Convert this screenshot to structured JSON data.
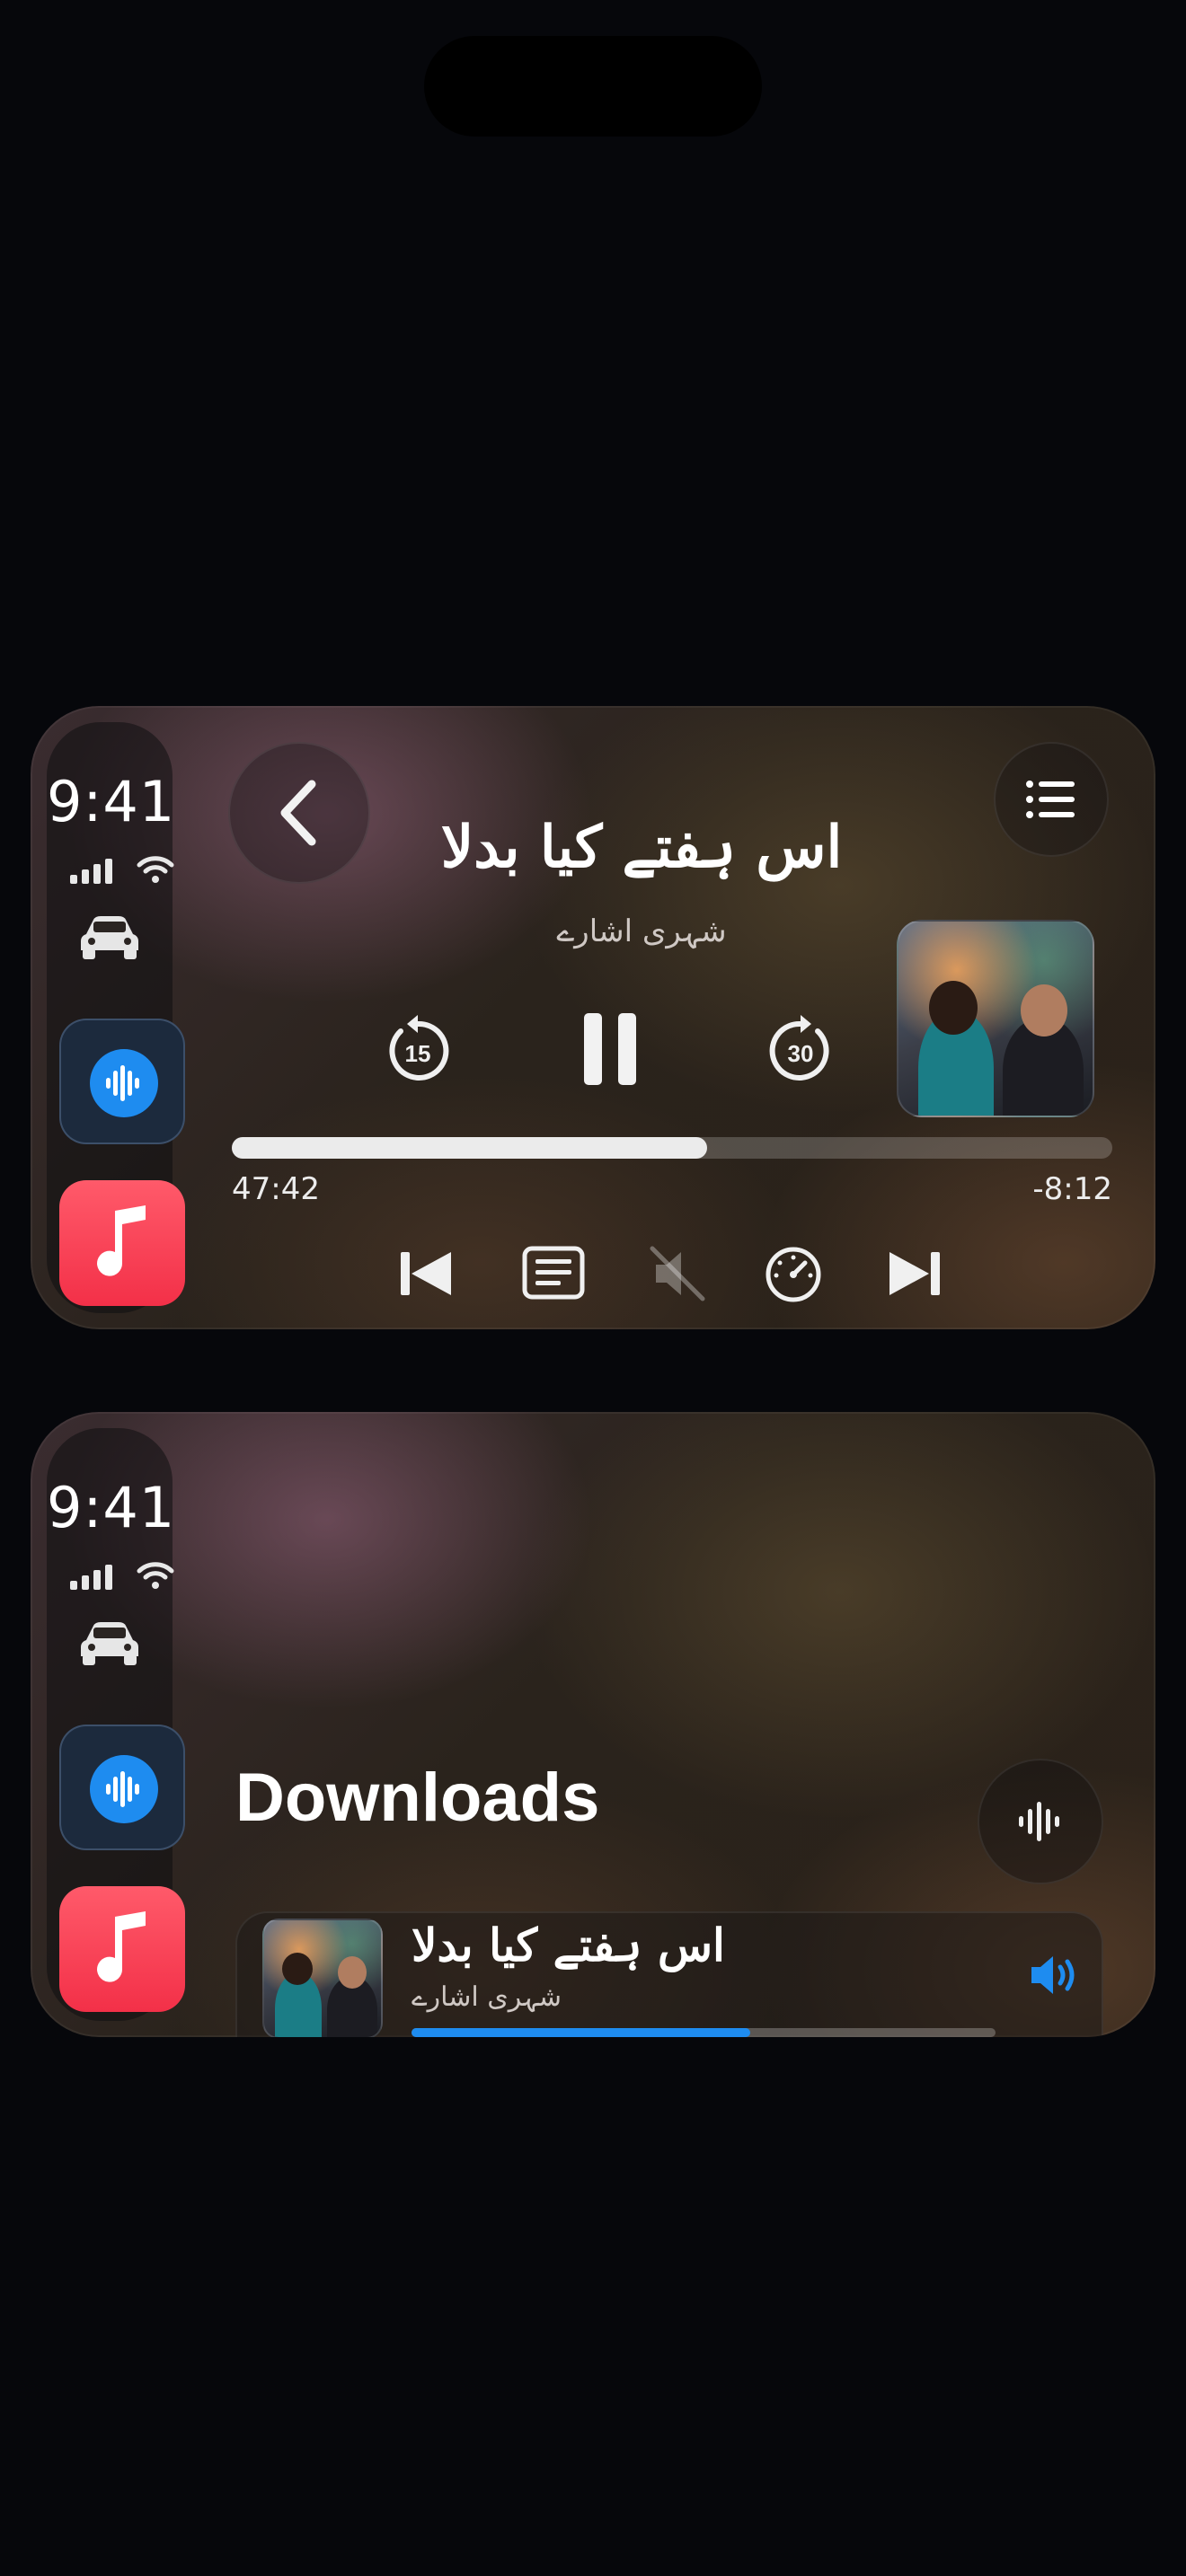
{
  "status": {
    "time": "9:41"
  },
  "player": {
    "title": "اس ہفتے کیا بدلا",
    "subtitle": "شہری اشارے",
    "elapsed": "47:42",
    "remaining": "-8:12",
    "progress_fraction": 0.54,
    "skip_back_seconds": "15",
    "skip_forward_seconds": "30",
    "icons": {
      "back": "chevron-left-icon",
      "queue": "list-icon",
      "previous": "previous-track-icon",
      "transcript": "transcript-icon",
      "mute": "speaker-muted-icon",
      "speed": "speedometer-icon",
      "next": "next-track-icon"
    }
  },
  "downloads": {
    "heading": "Downloads",
    "items": [
      {
        "title": "اس ہفتے کیا بدلا",
        "subtitle": "شہری اشارے",
        "progress_fraction": 0.58,
        "playing": true
      }
    ]
  },
  "colors": {
    "accent": "#1e8cf0",
    "music": "#f33048",
    "background": "#06070b"
  }
}
